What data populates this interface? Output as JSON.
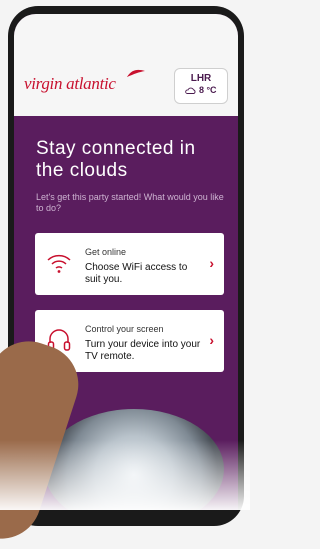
{
  "header": {
    "logo_text": "virgin atlantic",
    "weather": {
      "airport": "LHR",
      "temperature": "8 °C",
      "icon": "cloud-icon"
    }
  },
  "hero": {
    "title": "Stay connected in the clouds",
    "subtitle": "Let's get this party started! What would you like to do?"
  },
  "cards": [
    {
      "title": "Get online",
      "description": "Choose WiFi access to suit you.",
      "icon": "wifi-icon",
      "chevron": "›"
    },
    {
      "title": "Control your screen",
      "description": "Turn your device into your TV remote.",
      "icon": "headphones-icon",
      "chevron": "›"
    }
  ],
  "colors": {
    "brand_red": "#c8102e",
    "purple": "#5a1d5e",
    "text_dark": "#111111"
  }
}
